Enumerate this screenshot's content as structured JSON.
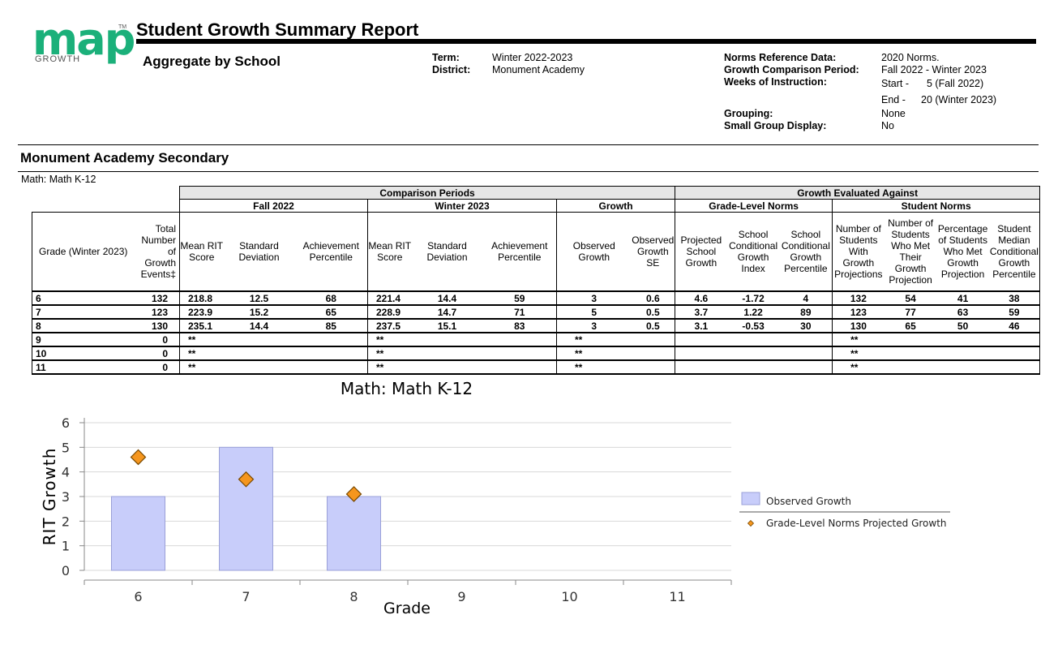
{
  "logo": {
    "word": "map",
    "tm": "TM",
    "sub": "GROWTH",
    "color": "#1bb07a"
  },
  "report": {
    "title": "Student Growth Summary Report",
    "subtitle": "Aggregate by School",
    "term_label": "Term:",
    "term_value": "Winter 2022-2023",
    "district_label": "District:",
    "district_value": "Monument Academy",
    "norms_label": "Norms Reference Data:",
    "norms_value": "2020 Norms.",
    "gcp_label": "Growth Comparison Period:",
    "gcp_value": "Fall 2022 - Winter 2023",
    "weeks_label": "Weeks of Instruction:",
    "start_label": "Start -",
    "start_value": "5 (Fall 2022)",
    "end_label": "End -",
    "end_value": "20 (Winter 2023)",
    "grouping_label": "Grouping:",
    "grouping_value": "None",
    "sgd_label": "Small Group Display:",
    "sgd_value": "No"
  },
  "school": {
    "name": "Monument Academy Secondary",
    "subject": "Math: Math K-12"
  },
  "table": {
    "band_comparison": "Comparison Periods",
    "band_evaluated": "Growth Evaluated Against",
    "sub_fall": "Fall 2022",
    "sub_winter": "Winter 2023",
    "sub_growth": "Growth",
    "sub_grade_norms": "Grade-Level Norms",
    "sub_student_norms": "Student Norms",
    "columns": [
      "Grade  (Winter 2023)",
      "Total Number of Growth Events‡",
      "Mean RIT Score",
      "Standard Deviation",
      "Achievement Percentile",
      "Mean RIT Score",
      "Standard Deviation",
      "Achievement Percentile",
      "Observed Growth",
      "Observed Growth SE",
      "Projected School Growth",
      "School Conditional Growth Index",
      "School Conditional Growth Percentile",
      "Number of Students With Growth Projections",
      "Number of Students Who Met Their Growth Projection",
      "Percentage of Students Who Met Growth Projection",
      "Student Median Conditional Growth Percentile"
    ],
    "rows": [
      [
        "6",
        "132",
        "218.8",
        "12.5",
        "68",
        "221.4",
        "14.4",
        "59",
        "3",
        "0.6",
        "4.6",
        "-1.72",
        "4",
        "132",
        "54",
        "41",
        "38"
      ],
      [
        "7",
        "123",
        "223.9",
        "15.2",
        "65",
        "228.9",
        "14.7",
        "71",
        "5",
        "0.5",
        "3.7",
        "1.22",
        "89",
        "123",
        "77",
        "63",
        "59"
      ],
      [
        "8",
        "130",
        "235.1",
        "14.4",
        "85",
        "237.5",
        "15.1",
        "83",
        "3",
        "0.5",
        "3.1",
        "-0.53",
        "30",
        "130",
        "65",
        "50",
        "46"
      ],
      [
        "9",
        "0",
        "**",
        "",
        "",
        "**",
        "",
        "",
        "**",
        "",
        "",
        "",
        "",
        "**",
        "",
        "",
        ""
      ],
      [
        "10",
        "0",
        "**",
        "",
        "",
        "**",
        "",
        "",
        "**",
        "",
        "",
        "",
        "",
        "**",
        "",
        "",
        ""
      ],
      [
        "11",
        "0",
        "**",
        "",
        "",
        "**",
        "",
        "",
        "**",
        "",
        "",
        "",
        "",
        "**",
        "",
        "",
        ""
      ]
    ]
  },
  "chart_data": {
    "type": "bar",
    "title": "Math: Math K-12",
    "xlabel": "Grade",
    "ylabel": "RIT Growth",
    "categories": [
      "6",
      "7",
      "8",
      "9",
      "10",
      "11"
    ],
    "ylim": [
      0,
      6
    ],
    "yticks": [
      0,
      1,
      2,
      3,
      4,
      5,
      6
    ],
    "grid": true,
    "legend_position": "right",
    "series": [
      {
        "name": "Observed Growth",
        "kind": "bar",
        "values": [
          3,
          5,
          3,
          null,
          null,
          null
        ],
        "color": "#c8cdfa",
        "stroke": "#9aa0d8"
      },
      {
        "name": "Grade-Level Norms Projected Growth",
        "kind": "marker",
        "values": [
          4.6,
          3.7,
          3.1,
          null,
          null,
          null
        ],
        "color": "#f5961e",
        "stroke": "#7a4a00"
      }
    ]
  }
}
